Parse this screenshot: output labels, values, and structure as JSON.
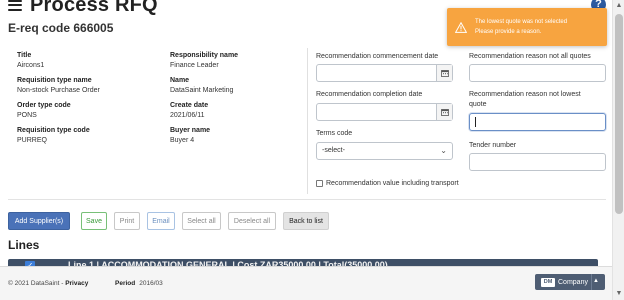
{
  "page": {
    "title": "Process RFQ",
    "ereq": "E-req code 666005"
  },
  "notification": {
    "line1": "The lowest quote was not selected",
    "line2": "Please provide a reason.",
    "color": "#f7a440"
  },
  "details": {
    "title": {
      "label": "Title",
      "value": "Aircons1"
    },
    "responsibility": {
      "label": "Responsibility name",
      "value": "Finance Leader"
    },
    "req_type_name": {
      "label": "Requisition type name",
      "value": "Non-stock Purchase Order"
    },
    "name": {
      "label": "Name",
      "value": "DataSaint Marketing"
    },
    "order_type": {
      "label": "Order type code",
      "value": "PONS"
    },
    "create_date": {
      "label": "Create date",
      "value": "2021/06/11"
    },
    "req_type_code": {
      "label": "Requisition type code",
      "value": "PURREQ"
    },
    "buyer": {
      "label": "Buyer name",
      "value": "Buyer 4"
    }
  },
  "form": {
    "commencement_label": "Recommendation commencement date",
    "completion_label": "Recommendation completion date",
    "terms_label": "Terms code",
    "terms_value": "-select-",
    "reason_all_label": "Recommendation reason not all quotes",
    "reason_lowest_label_1": "Recommendation reason not lowest",
    "reason_lowest_label_2": "quote",
    "tender_label": "Tender number",
    "transport_label": "Recommendation value including transport"
  },
  "actions": {
    "add_supplier": "Add Supplier(s)",
    "save": "Save",
    "print": "Print",
    "email": "Email",
    "select_all": "Select all",
    "deselect_all": "Deselect all",
    "back": "Back to list"
  },
  "lines": {
    "title": "Lines",
    "line1": "Line 1 | ACCOMMODATION GENERAL | Cost ZAR35000.00 | Total(35000.00)"
  },
  "footer": {
    "copyright": "© 2021 DataSaint - ",
    "privacy": "Privacy",
    "period_label": "Period",
    "period_value": "2016/03",
    "company_badge": "DM",
    "company_label": "Company"
  },
  "colors": {
    "primary": "#4a72b8",
    "success": "#3a9a3a",
    "header_bar": "#3e4f66",
    "company": "#4e5d73"
  }
}
